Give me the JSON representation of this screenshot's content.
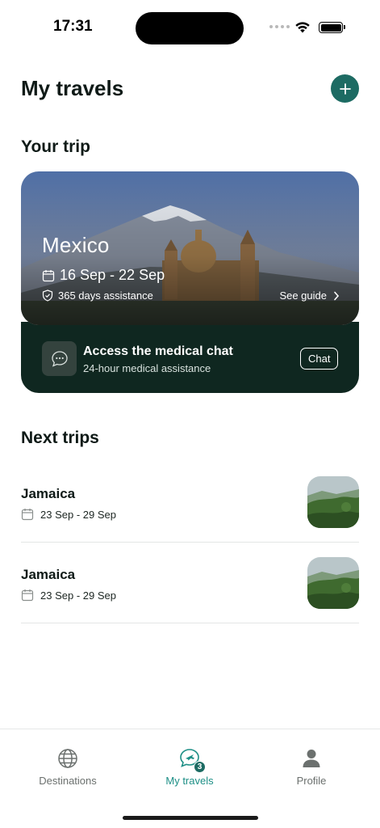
{
  "status_bar": {
    "time": "17:31"
  },
  "header": {
    "title": "My travels",
    "add_icon": "plus-icon"
  },
  "current_trip": {
    "section_title": "Your trip",
    "destination": "Mexico",
    "dates": "16 Sep - 22 Sep",
    "assistance": "365 days assistance",
    "guide_label": "See guide"
  },
  "medical_chat": {
    "title": "Access the medical chat",
    "subtitle": "24-hour medical assistance",
    "button_label": "Chat"
  },
  "next_trips": {
    "section_title": "Next trips",
    "items": [
      {
        "name": "Jamaica",
        "dates": "23 Sep - 29 Sep"
      },
      {
        "name": "Jamaica",
        "dates": "23 Sep - 29 Sep"
      }
    ]
  },
  "tab_bar": {
    "tabs": [
      {
        "label": "Destinations",
        "icon": "globe-icon"
      },
      {
        "label": "My travels",
        "icon": "chat-plane-icon",
        "badge": "3"
      },
      {
        "label": "Profile",
        "icon": "person-icon"
      }
    ],
    "active_color": "#1d8f86"
  },
  "colors": {
    "accent": "#1d6b63",
    "chat_card_bg": "#0f2720"
  }
}
